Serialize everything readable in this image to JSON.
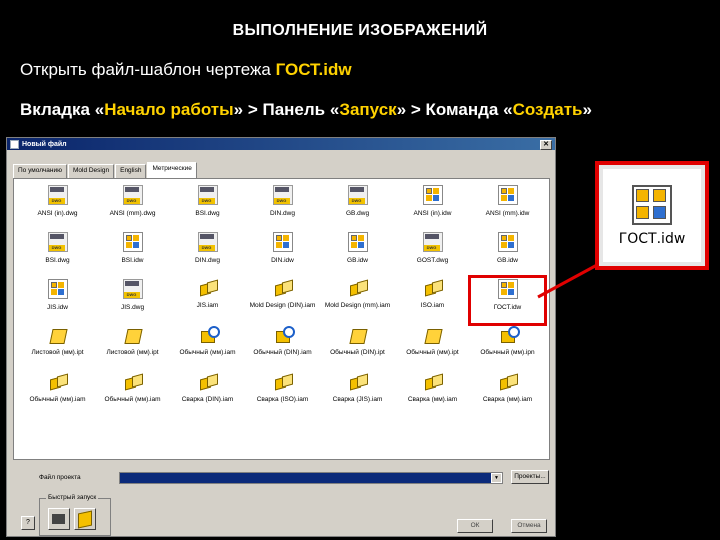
{
  "slide": {
    "title": "ВЫПОЛНЕНИЕ ИЗОБРАЖЕНИЙ",
    "line1_text": "Открыть файл-шаблон чертежа ",
    "line1_highlight": "ГОСТ.idw",
    "line2": {
      "p1": "Вкладка «",
      "h1": "Начало работы",
      "p2": "» > Панель «",
      "h2": "Запуск",
      "p3": "» > Команда «",
      "h3": "Создать",
      "p4": "»"
    }
  },
  "dialog": {
    "title": "Новый файл",
    "close_label": "✕",
    "tabs": [
      {
        "label": "По умолчанию",
        "active": false
      },
      {
        "label": "Mold Design",
        "active": false
      },
      {
        "label": "English",
        "active": false
      },
      {
        "label": "Метрические",
        "active": true
      }
    ],
    "files": [
      {
        "name": "ANSI (in).dwg",
        "icon": "dwg"
      },
      {
        "name": "ANSI (mm).dwg",
        "icon": "dwg"
      },
      {
        "name": "BSI.dwg",
        "icon": "dwg"
      },
      {
        "name": "DIN.dwg",
        "icon": "dwg"
      },
      {
        "name": "GB.dwg",
        "icon": "dwg"
      },
      {
        "name": "ANSI (in).idw",
        "icon": "idw"
      },
      {
        "name": "ANSI (mm).idw",
        "icon": "idw"
      },
      {
        "name": "BSI.dwg",
        "icon": "dwg"
      },
      {
        "name": "BSI.idw",
        "icon": "idw"
      },
      {
        "name": "DIN.dwg",
        "icon": "dwg"
      },
      {
        "name": "DIN.idw",
        "icon": "idw"
      },
      {
        "name": "GB.idw",
        "icon": "idw"
      },
      {
        "name": "GOST.dwg",
        "icon": "dwg"
      },
      {
        "name": "GB.idw",
        "icon": "idw"
      },
      {
        "name": "JIS.idw",
        "icon": "idw"
      },
      {
        "name": "JIS.dwg",
        "icon": "dwg"
      },
      {
        "name": "JIS.iam",
        "icon": "iam"
      },
      {
        "name": "Mold Design (DIN).iam",
        "icon": "iam"
      },
      {
        "name": "Mold Design (mm).iam",
        "icon": "iam"
      },
      {
        "name": "ISO.iam",
        "icon": "iam"
      },
      {
        "name": "ГОСТ.idw",
        "icon": "idw",
        "selected": true
      },
      {
        "name": "Листовой (мм).ipt",
        "icon": "ipt"
      },
      {
        "name": "Листовой (мм).ipt",
        "icon": "ipt"
      },
      {
        "name": "Обычный (мм).iam",
        "icon": "ipn"
      },
      {
        "name": "Обычный (DIN).iam",
        "icon": "ipn"
      },
      {
        "name": "Обычный (DIN).ipt",
        "icon": "ipt"
      },
      {
        "name": "Обычный (мм).ipt",
        "icon": "ipt"
      },
      {
        "name": "Обычный (мм).ipn",
        "icon": "ipn"
      },
      {
        "name": "Обычный (мм).iam",
        "icon": "iam"
      },
      {
        "name": "Обычный (мм).iam",
        "icon": "iam"
      },
      {
        "name": "Сварка (DIN).iam",
        "icon": "iam"
      },
      {
        "name": "Сварка (ISO).iam",
        "icon": "iam"
      },
      {
        "name": "Сварка (JIS).iam",
        "icon": "iam"
      },
      {
        "name": "Сварка (мм).iam",
        "icon": "iam"
      },
      {
        "name": "Сварка (мм).iam",
        "icon": "iam"
      }
    ],
    "project_label": "Файл проекта",
    "project_button": "Проекты...",
    "quick_launch_label": "Быстрый запуск",
    "help_label": "?",
    "ok_label": "ОК",
    "cancel_label": "Отмена"
  },
  "callout": {
    "caption": "ГОСТ.idw",
    "border_color": "#e00000"
  },
  "colors": {
    "accent_text": "#ffd200",
    "highlight_border": "#e00000",
    "background": "#000000"
  }
}
